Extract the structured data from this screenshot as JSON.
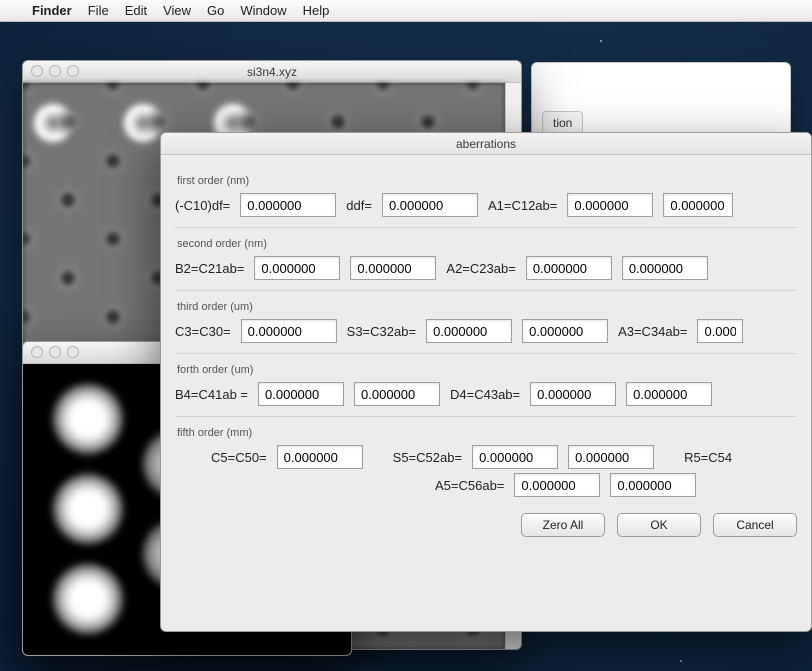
{
  "menubar": {
    "app": "Finder",
    "items": [
      "File",
      "Edit",
      "View",
      "Go",
      "Window",
      "Help"
    ]
  },
  "bgwin": {
    "tab_label_suffix": "tion"
  },
  "winA": {
    "title": "si3n4.xyz"
  },
  "winB": {
    "title": ""
  },
  "dlg": {
    "title": "aberrations",
    "section1": "first order (nm)",
    "section2": "second order (nm)",
    "section3": "third order (um)",
    "section4": "forth order (um)",
    "section5": "fifth order (mm)",
    "labels": {
      "c10": "(-C10)df=",
      "ddf": "ddf=",
      "a1": "A1=C12ab=",
      "b2": "B2=C21ab=",
      "a2": "A2=C23ab=",
      "c3": "C3=C30=",
      "s3": "S3=C32ab=",
      "a3": "A3=C34ab=",
      "b4": "B4=C41ab =",
      "d4": "D4=C43ab=",
      "c5": "C5=C50=",
      "s5": "S5=C52ab=",
      "r5": "R5=C54",
      "a5": "A5=C56ab="
    },
    "values": {
      "c10": "0.000000",
      "ddf": "0.000000",
      "a1a": "0.000000",
      "a1b": "0.000000",
      "b2a": "0.000000",
      "b2b": "0.000000",
      "a2a": "0.000000",
      "a2b": "0.000000",
      "c3": "0.000000",
      "s3a": "0.000000",
      "s3b": "0.000000",
      "a3": "0.000",
      "b4a": "0.000000",
      "b4b": "0.000000",
      "d4a": "0.000000",
      "d4b": "0.000000",
      "c5": "0.000000",
      "s5a": "0.000000",
      "s5b": "0.000000",
      "a5a": "0.000000",
      "a5b": "0.000000"
    },
    "buttons": {
      "zero": "Zero All",
      "ok": "OK",
      "cancel": "Cancel"
    }
  }
}
